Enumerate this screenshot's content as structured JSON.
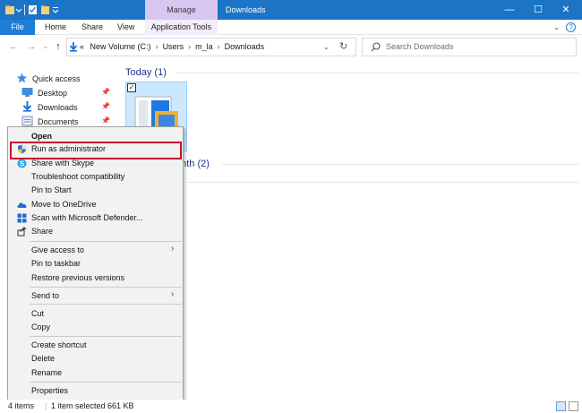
{
  "window": {
    "title": "Downloads",
    "contextual_group": "Manage",
    "controls": {
      "minimize": "—",
      "maximize": "☐",
      "close": "✕"
    }
  },
  "ribbon": {
    "file": "File",
    "tabs": [
      "Home",
      "Share",
      "View"
    ],
    "contextual_tab": "Application Tools",
    "help_glyph": "?"
  },
  "address": {
    "crumbs": [
      "New Volume (C:)",
      "Users",
      "m_la",
      "Downloads"
    ],
    "overflow": "«",
    "search_placeholder": "Search Downloads"
  },
  "nav": {
    "quick_access": "Quick access",
    "items": [
      "Desktop",
      "Downloads",
      "Documents"
    ]
  },
  "content": {
    "group_today": "Today (1)",
    "group_month_fragment": "onth (2)"
  },
  "context_menu": {
    "items": {
      "open": "Open",
      "run_admin": "Run as administrator",
      "skype": "Share with Skype",
      "troubleshoot": "Troubleshoot compatibility",
      "pin_start": "Pin to Start",
      "onedrive": "Move to OneDrive",
      "defender": "Scan with Microsoft Defender...",
      "share": "Share",
      "give_access": "Give access to",
      "pin_taskbar": "Pin to taskbar",
      "restore": "Restore previous versions",
      "send_to": "Send to",
      "cut": "Cut",
      "copy": "Copy",
      "create_shortcut": "Create shortcut",
      "delete": "Delete",
      "rename": "Rename",
      "properties": "Properties"
    },
    "submenu_arrow": "›",
    "highlight_color": "#c8102e"
  },
  "status": {
    "items": "4 items",
    "selected": "1 item selected  661 KB"
  },
  "colors": {
    "titlebar": "#1b74c6",
    "manage": "#d8c7f1",
    "group_header": "#1e3287"
  }
}
